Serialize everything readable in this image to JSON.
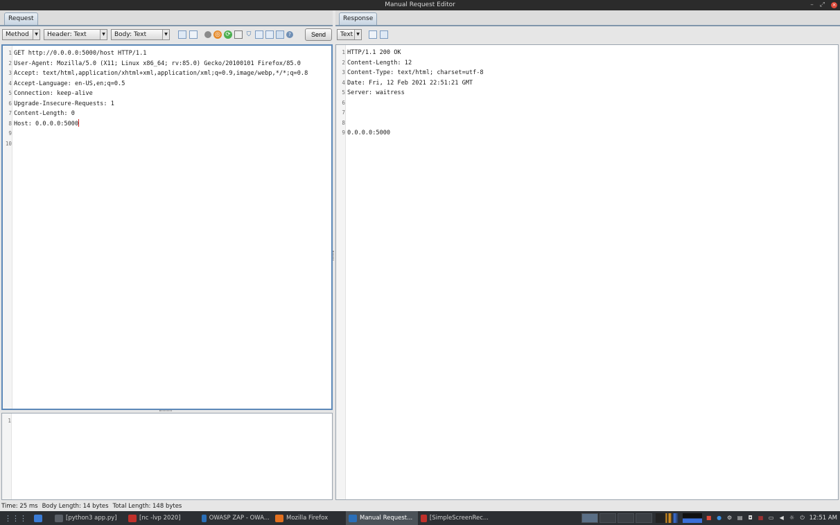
{
  "window": {
    "title": "Manual Request Editor"
  },
  "request_panel": {
    "tab_label": "Request",
    "method_combo": "Method",
    "header_combo": "Header: Text",
    "body_combo": "Body: Text",
    "send_label": "Send",
    "header_lines": [
      {
        "n": "1",
        "text": "GET http://0.0.0.0:5000/host HTTP/1.1"
      },
      {
        "n": "2",
        "text": "User-Agent: Mozilla/5.0 (X11; Linux x86_64; rv:85.0) Gecko/20100101 Firefox/85.0"
      },
      {
        "n": "3",
        "text": "Accept: text/html,application/xhtml+xml,application/xml;q=0.9,image/webp,*/*;q=0.8"
      },
      {
        "n": "4",
        "text": "Accept-Language: en-US,en;q=0.5"
      },
      {
        "n": "5",
        "text": "Connection: keep-alive"
      },
      {
        "n": "6",
        "text": "Upgrade-Insecure-Requests: 1"
      },
      {
        "n": "7",
        "text": "Content-Length: 0"
      },
      {
        "n": "8",
        "text": "Host: 0.0.0.0:5000"
      },
      {
        "n": "9",
        "text": ""
      },
      {
        "n": "10",
        "text": ""
      }
    ],
    "body_lines": [
      {
        "n": "1",
        "text": ""
      }
    ]
  },
  "response_panel": {
    "tab_label": "Response",
    "view_combo": "Text",
    "lines": [
      {
        "n": "1",
        "text": "HTTP/1.1 200 OK"
      },
      {
        "n": "2",
        "text": "Content-Length: 12"
      },
      {
        "n": "3",
        "text": "Content-Type: text/html; charset=utf-8"
      },
      {
        "n": "4",
        "text": "Date: Fri, 12 Feb 2021 22:51:21 GMT"
      },
      {
        "n": "5",
        "text": "Server: waitress"
      },
      {
        "n": "6",
        "text": ""
      },
      {
        "n": "7",
        "text": ""
      },
      {
        "n": "8",
        "text": ""
      },
      {
        "n": "9",
        "text": "0.0.0.0:5000"
      }
    ]
  },
  "status": {
    "time": "Time: 25 ms",
    "body_length": "Body Length: 14 bytes",
    "total_length": "Total Length: 148 bytes"
  },
  "taskbar": {
    "tasks": [
      {
        "label": "[python3 app.py]",
        "icon": "terminal-icon",
        "color": "#5a5f66"
      },
      {
        "label": "[nc -lvp 2020]",
        "icon": "terminal-icon",
        "color": "#c0302a"
      },
      {
        "label": "OWASP ZAP - OWA...",
        "icon": "zap-icon",
        "color": "#2a6fb8"
      },
      {
        "label": "Mozilla Firefox",
        "icon": "firefox-icon",
        "color": "#e2701f"
      },
      {
        "label": "Manual Request...",
        "icon": "zap-icon",
        "color": "#2a6fb8"
      },
      {
        "label": "[SimpleScreenRec...",
        "icon": "recorder-icon",
        "color": "#c0302a"
      }
    ],
    "clock": "12:51 AM"
  }
}
